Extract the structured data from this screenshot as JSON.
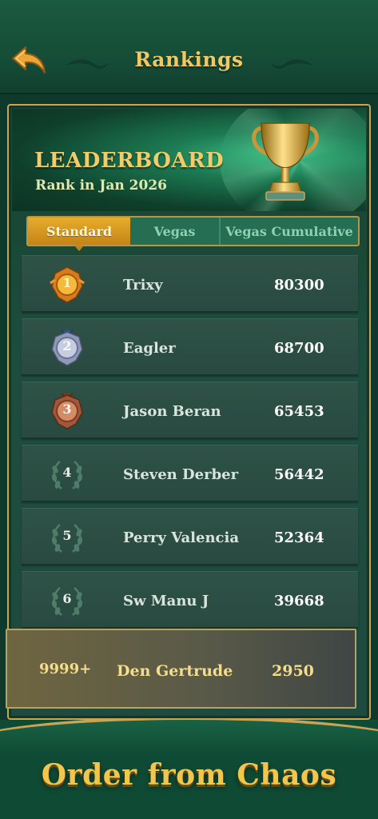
{
  "header": {
    "title": "Rankings",
    "back_icon": "back-arrow-icon"
  },
  "banner": {
    "title": "LEADERBOARD",
    "subtitle": "Rank in Jan 2026",
    "trophy_icon": "trophy-icon"
  },
  "tabs": [
    {
      "label": "Standard",
      "active": true
    },
    {
      "label": "Vegas",
      "active": false
    },
    {
      "label": "Vegas Cumulative",
      "active": false
    }
  ],
  "rows": [
    {
      "rank": "1",
      "badge": "gold-medal-icon",
      "name": "Trixy",
      "score": "80300"
    },
    {
      "rank": "2",
      "badge": "silver-medal-icon",
      "name": "Eagler",
      "score": "68700"
    },
    {
      "rank": "3",
      "badge": "bronze-medal-icon",
      "name": "Jason Beran",
      "score": "65453"
    },
    {
      "rank": "4",
      "badge": "laurel-wreath-icon",
      "name": "Steven Derber",
      "score": "56442"
    },
    {
      "rank": "5",
      "badge": "laurel-wreath-icon",
      "name": "Perry Valencia",
      "score": "52364"
    },
    {
      "rank": "6",
      "badge": "laurel-wreath-icon",
      "name": "Sw Manu J",
      "score": "39668"
    }
  ],
  "my_row": {
    "rank": "9999+",
    "name": "Den Gertrude",
    "score": "2950"
  },
  "footer": {
    "tagline": "Order from Chaos"
  },
  "colors": {
    "gold": "#f2c64c",
    "green_dark": "#0f3a2b",
    "tab_active": "#e7ad2c"
  }
}
